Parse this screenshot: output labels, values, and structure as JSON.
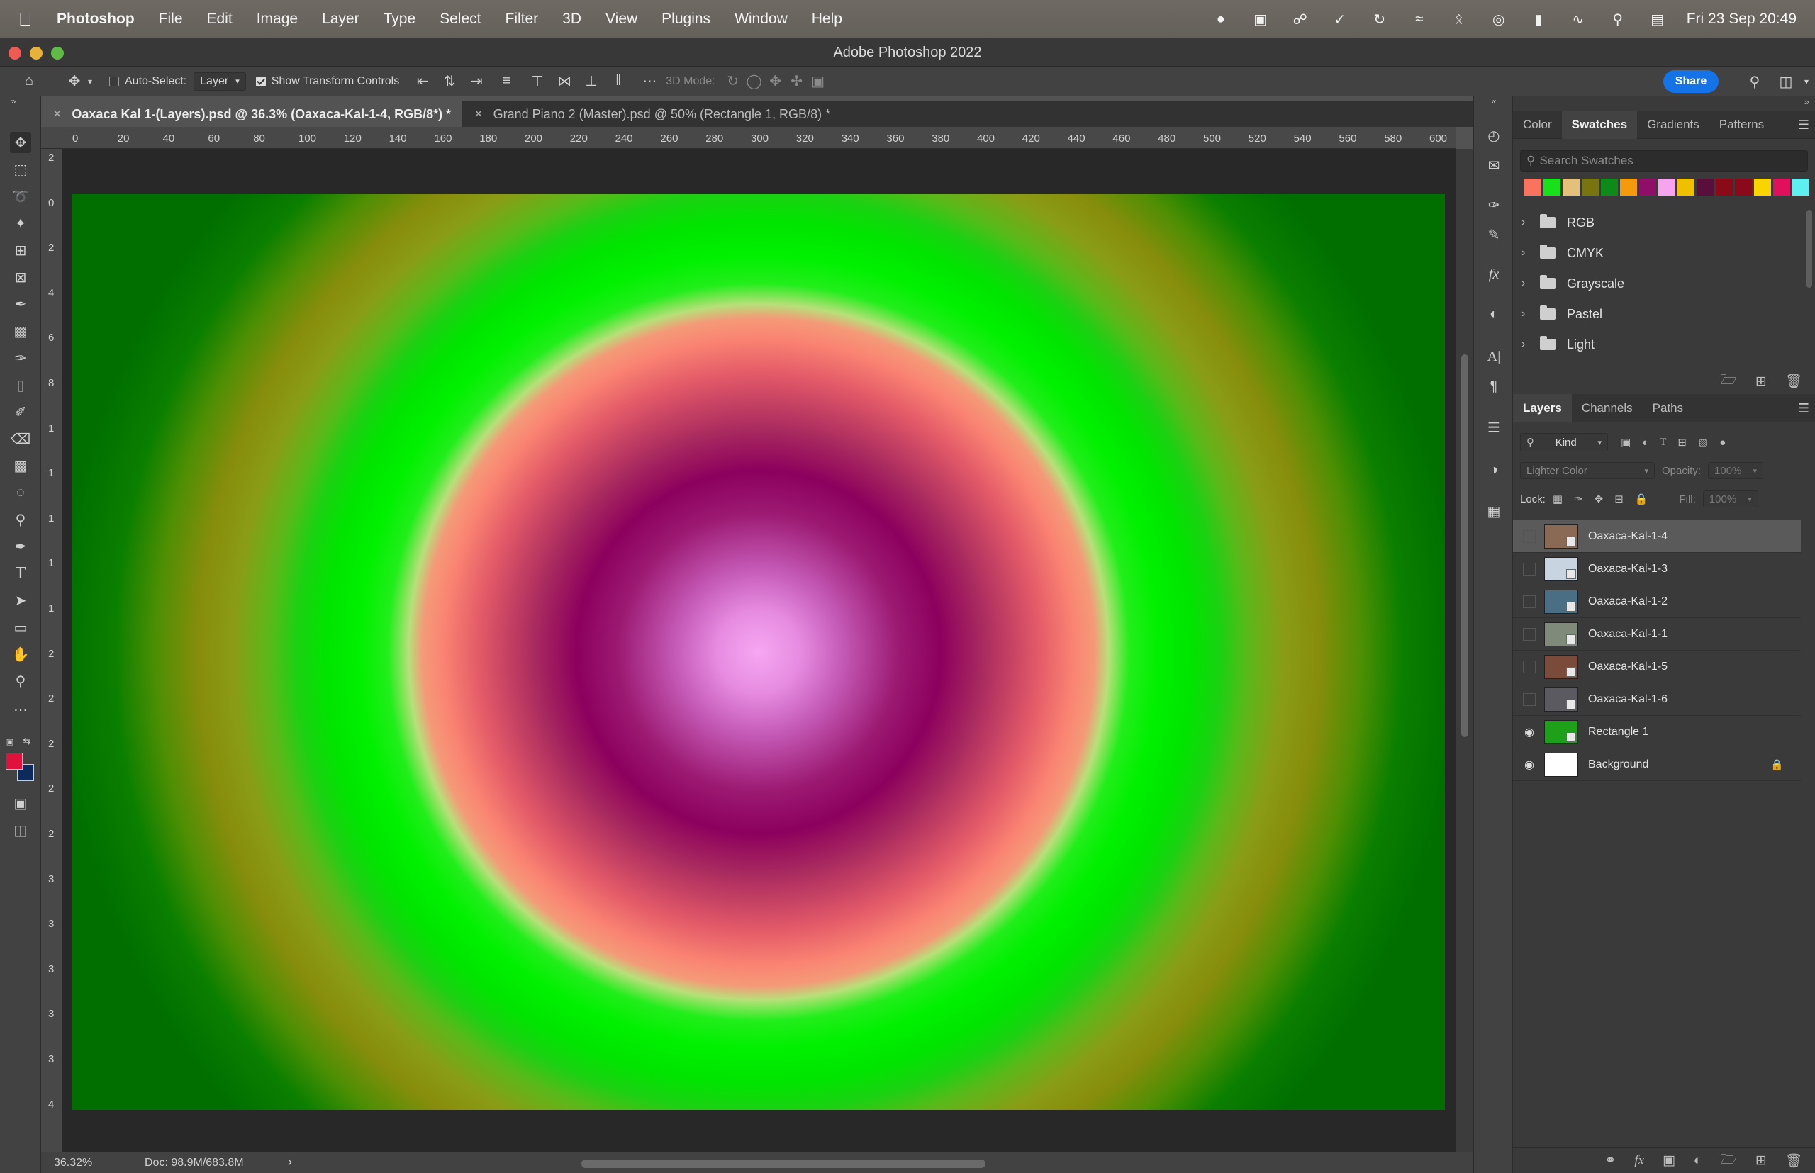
{
  "menubar": {
    "app_name": "Photoshop",
    "items": [
      "File",
      "Edit",
      "Image",
      "Layer",
      "Type",
      "Select",
      "Filter",
      "3D",
      "View",
      "Plugins",
      "Window",
      "Help"
    ],
    "clock": "Fri 23 Sep  20:49"
  },
  "window": {
    "title": "Adobe Photoshop 2022"
  },
  "options_bar": {
    "auto_select_label": "Auto-Select:",
    "auto_select_value": "Layer",
    "show_transform_label": "Show Transform Controls",
    "mode_3d_label": "3D Mode:",
    "share_label": "Share"
  },
  "tabs": [
    {
      "label": "Oaxaca Kal 1-(Layers).psd @ 36.3% (Oaxaca-Kal-1-4, RGB/8*) *",
      "active": true
    },
    {
      "label": "Grand Piano 2 (Master).psd @ 50% (Rectangle 1, RGB/8) *",
      "active": false
    }
  ],
  "rulers": {
    "h_ticks": [
      "0",
      "20",
      "40",
      "60",
      "80",
      "100",
      "120",
      "140",
      "160",
      "180",
      "200",
      "220",
      "240",
      "260",
      "280",
      "300",
      "320",
      "340",
      "360",
      "380",
      "400",
      "420",
      "440",
      "460",
      "480",
      "500",
      "520",
      "540",
      "560",
      "580",
      "600"
    ],
    "v_ticks": [
      "2",
      "0",
      "2",
      "4",
      "6",
      "8",
      "1",
      "1",
      "1",
      "1",
      "1",
      "2",
      "2",
      "2",
      "2",
      "2",
      "3",
      "3",
      "3",
      "3",
      "3",
      "4"
    ]
  },
  "status": {
    "zoom": "36.32%",
    "doc_info": "Doc: 98.9M/683.8M",
    "arrow": "›"
  },
  "swatches_panel": {
    "tabs": [
      "Color",
      "Swatches",
      "Gradients",
      "Patterns"
    ],
    "active_tab": "Swatches",
    "search_placeholder": "Search Swatches",
    "recent_colors": [
      "#f9735f",
      "#18e01a",
      "#e5c07a",
      "#7a7410",
      "#0d8a1a",
      "#f59b0b",
      "#8f0e66",
      "#f7a4ef",
      "#f0c000",
      "#5a0e3c",
      "#8a0b17",
      "#8a0a1c",
      "#f9d400",
      "#e0105c",
      "#5ef0f0"
    ],
    "folders": [
      "RGB",
      "CMYK",
      "Grayscale",
      "Pastel",
      "Light"
    ]
  },
  "layers_panel": {
    "tabs": [
      "Layers",
      "Channels",
      "Paths"
    ],
    "active_tab": "Layers",
    "filter_label": "Kind",
    "blend_mode": "Lighter Color",
    "opacity_label": "Opacity:",
    "opacity_value": "100%",
    "lock_label": "Lock:",
    "fill_label": "Fill:",
    "fill_value": "100%",
    "layers": [
      {
        "name": "Oaxaca-Kal-1-4",
        "visible": false,
        "selected": true,
        "thumb": "#8a6a55"
      },
      {
        "name": "Oaxaca-Kal-1-3",
        "visible": false,
        "selected": false,
        "thumb": "#c8d4e0"
      },
      {
        "name": "Oaxaca-Kal-1-2",
        "visible": false,
        "selected": false,
        "thumb": "#4a6f84"
      },
      {
        "name": "Oaxaca-Kal-1-1",
        "visible": false,
        "selected": false,
        "thumb": "#7f8a7a"
      },
      {
        "name": "Oaxaca-Kal-1-5",
        "visible": false,
        "selected": false,
        "thumb": "#7a4a3a"
      },
      {
        "name": "Oaxaca-Kal-1-6",
        "visible": false,
        "selected": false,
        "thumb": "#5a5a60"
      },
      {
        "name": "Rectangle 1",
        "visible": true,
        "selected": false,
        "thumb": "#1fa01a"
      },
      {
        "name": "Background",
        "visible": true,
        "selected": false,
        "thumb": "#ffffff",
        "locked": true
      }
    ]
  }
}
